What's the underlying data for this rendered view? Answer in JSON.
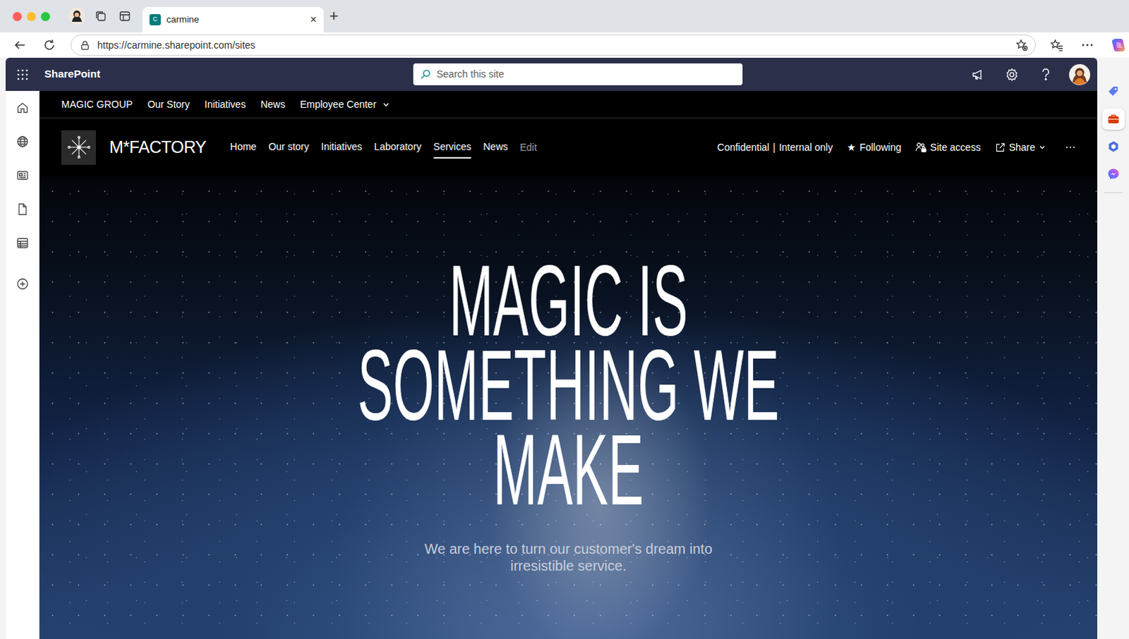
{
  "browser": {
    "tab_title": "carmine",
    "favicon_letter": "C",
    "tab_close": "×",
    "new_tab": "+",
    "url": "https://carmine.sharepoint.com/sites"
  },
  "edge_sidebar": {
    "items": [
      {
        "selected": false
      },
      {
        "selected": true
      },
      {
        "selected": false
      },
      {
        "selected": false
      }
    ]
  },
  "suite_bar": {
    "app_name": "SharePoint",
    "search": {
      "placeholder": "Search this site"
    }
  },
  "hub_nav": {
    "site": "MAGIC GROUP",
    "items": [
      {
        "label": "Our Story",
        "dropdown": false
      },
      {
        "label": "Initiatives",
        "dropdown": false
      },
      {
        "label": "News",
        "dropdown": false
      },
      {
        "label": "Employee Center",
        "dropdown": true
      }
    ]
  },
  "site_header": {
    "title": "M*FACTORY",
    "nav": [
      {
        "label": "Home",
        "selected": false
      },
      {
        "label": "Our story",
        "selected": false
      },
      {
        "label": "Initiatives",
        "selected": false
      },
      {
        "label": "Laboratory",
        "selected": false
      },
      {
        "label": "Services",
        "selected": true
      },
      {
        "label": "News",
        "selected": false
      }
    ],
    "edit": "Edit",
    "sensitivity": "Confidential",
    "sensitivity_separator": "|",
    "sensitivity_scope": "Internal only",
    "following_icon": "★",
    "following_label": "Following",
    "following": true,
    "site_access": "Site access",
    "share": "Share"
  },
  "hero": {
    "heading_lines": [
      "MAGIC IS",
      "SOMETHING WE",
      "MAKE"
    ],
    "subtitle": "We are here to turn our customer's dream into irresistible service."
  }
}
